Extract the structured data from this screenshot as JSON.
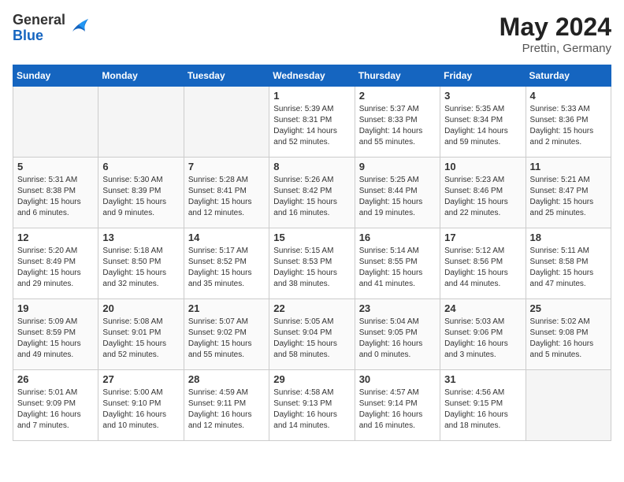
{
  "logo": {
    "general": "General",
    "blue": "Blue"
  },
  "title": {
    "month": "May 2024",
    "location": "Prettin, Germany"
  },
  "weekdays": [
    "Sunday",
    "Monday",
    "Tuesday",
    "Wednesday",
    "Thursday",
    "Friday",
    "Saturday"
  ],
  "weeks": [
    [
      {
        "day": "",
        "info": ""
      },
      {
        "day": "",
        "info": ""
      },
      {
        "day": "",
        "info": ""
      },
      {
        "day": "1",
        "info": "Sunrise: 5:39 AM\nSunset: 8:31 PM\nDaylight: 14 hours and 52 minutes."
      },
      {
        "day": "2",
        "info": "Sunrise: 5:37 AM\nSunset: 8:33 PM\nDaylight: 14 hours and 55 minutes."
      },
      {
        "day": "3",
        "info": "Sunrise: 5:35 AM\nSunset: 8:34 PM\nDaylight: 14 hours and 59 minutes."
      },
      {
        "day": "4",
        "info": "Sunrise: 5:33 AM\nSunset: 8:36 PM\nDaylight: 15 hours and 2 minutes."
      }
    ],
    [
      {
        "day": "5",
        "info": "Sunrise: 5:31 AM\nSunset: 8:38 PM\nDaylight: 15 hours and 6 minutes."
      },
      {
        "day": "6",
        "info": "Sunrise: 5:30 AM\nSunset: 8:39 PM\nDaylight: 15 hours and 9 minutes."
      },
      {
        "day": "7",
        "info": "Sunrise: 5:28 AM\nSunset: 8:41 PM\nDaylight: 15 hours and 12 minutes."
      },
      {
        "day": "8",
        "info": "Sunrise: 5:26 AM\nSunset: 8:42 PM\nDaylight: 15 hours and 16 minutes."
      },
      {
        "day": "9",
        "info": "Sunrise: 5:25 AM\nSunset: 8:44 PM\nDaylight: 15 hours and 19 minutes."
      },
      {
        "day": "10",
        "info": "Sunrise: 5:23 AM\nSunset: 8:46 PM\nDaylight: 15 hours and 22 minutes."
      },
      {
        "day": "11",
        "info": "Sunrise: 5:21 AM\nSunset: 8:47 PM\nDaylight: 15 hours and 25 minutes."
      }
    ],
    [
      {
        "day": "12",
        "info": "Sunrise: 5:20 AM\nSunset: 8:49 PM\nDaylight: 15 hours and 29 minutes."
      },
      {
        "day": "13",
        "info": "Sunrise: 5:18 AM\nSunset: 8:50 PM\nDaylight: 15 hours and 32 minutes."
      },
      {
        "day": "14",
        "info": "Sunrise: 5:17 AM\nSunset: 8:52 PM\nDaylight: 15 hours and 35 minutes."
      },
      {
        "day": "15",
        "info": "Sunrise: 5:15 AM\nSunset: 8:53 PM\nDaylight: 15 hours and 38 minutes."
      },
      {
        "day": "16",
        "info": "Sunrise: 5:14 AM\nSunset: 8:55 PM\nDaylight: 15 hours and 41 minutes."
      },
      {
        "day": "17",
        "info": "Sunrise: 5:12 AM\nSunset: 8:56 PM\nDaylight: 15 hours and 44 minutes."
      },
      {
        "day": "18",
        "info": "Sunrise: 5:11 AM\nSunset: 8:58 PM\nDaylight: 15 hours and 47 minutes."
      }
    ],
    [
      {
        "day": "19",
        "info": "Sunrise: 5:09 AM\nSunset: 8:59 PM\nDaylight: 15 hours and 49 minutes."
      },
      {
        "day": "20",
        "info": "Sunrise: 5:08 AM\nSunset: 9:01 PM\nDaylight: 15 hours and 52 minutes."
      },
      {
        "day": "21",
        "info": "Sunrise: 5:07 AM\nSunset: 9:02 PM\nDaylight: 15 hours and 55 minutes."
      },
      {
        "day": "22",
        "info": "Sunrise: 5:05 AM\nSunset: 9:04 PM\nDaylight: 15 hours and 58 minutes."
      },
      {
        "day": "23",
        "info": "Sunrise: 5:04 AM\nSunset: 9:05 PM\nDaylight: 16 hours and 0 minutes."
      },
      {
        "day": "24",
        "info": "Sunrise: 5:03 AM\nSunset: 9:06 PM\nDaylight: 16 hours and 3 minutes."
      },
      {
        "day": "25",
        "info": "Sunrise: 5:02 AM\nSunset: 9:08 PM\nDaylight: 16 hours and 5 minutes."
      }
    ],
    [
      {
        "day": "26",
        "info": "Sunrise: 5:01 AM\nSunset: 9:09 PM\nDaylight: 16 hours and 7 minutes."
      },
      {
        "day": "27",
        "info": "Sunrise: 5:00 AM\nSunset: 9:10 PM\nDaylight: 16 hours and 10 minutes."
      },
      {
        "day": "28",
        "info": "Sunrise: 4:59 AM\nSunset: 9:11 PM\nDaylight: 16 hours and 12 minutes."
      },
      {
        "day": "29",
        "info": "Sunrise: 4:58 AM\nSunset: 9:13 PM\nDaylight: 16 hours and 14 minutes."
      },
      {
        "day": "30",
        "info": "Sunrise: 4:57 AM\nSunset: 9:14 PM\nDaylight: 16 hours and 16 minutes."
      },
      {
        "day": "31",
        "info": "Sunrise: 4:56 AM\nSunset: 9:15 PM\nDaylight: 16 hours and 18 minutes."
      },
      {
        "day": "",
        "info": ""
      }
    ]
  ]
}
